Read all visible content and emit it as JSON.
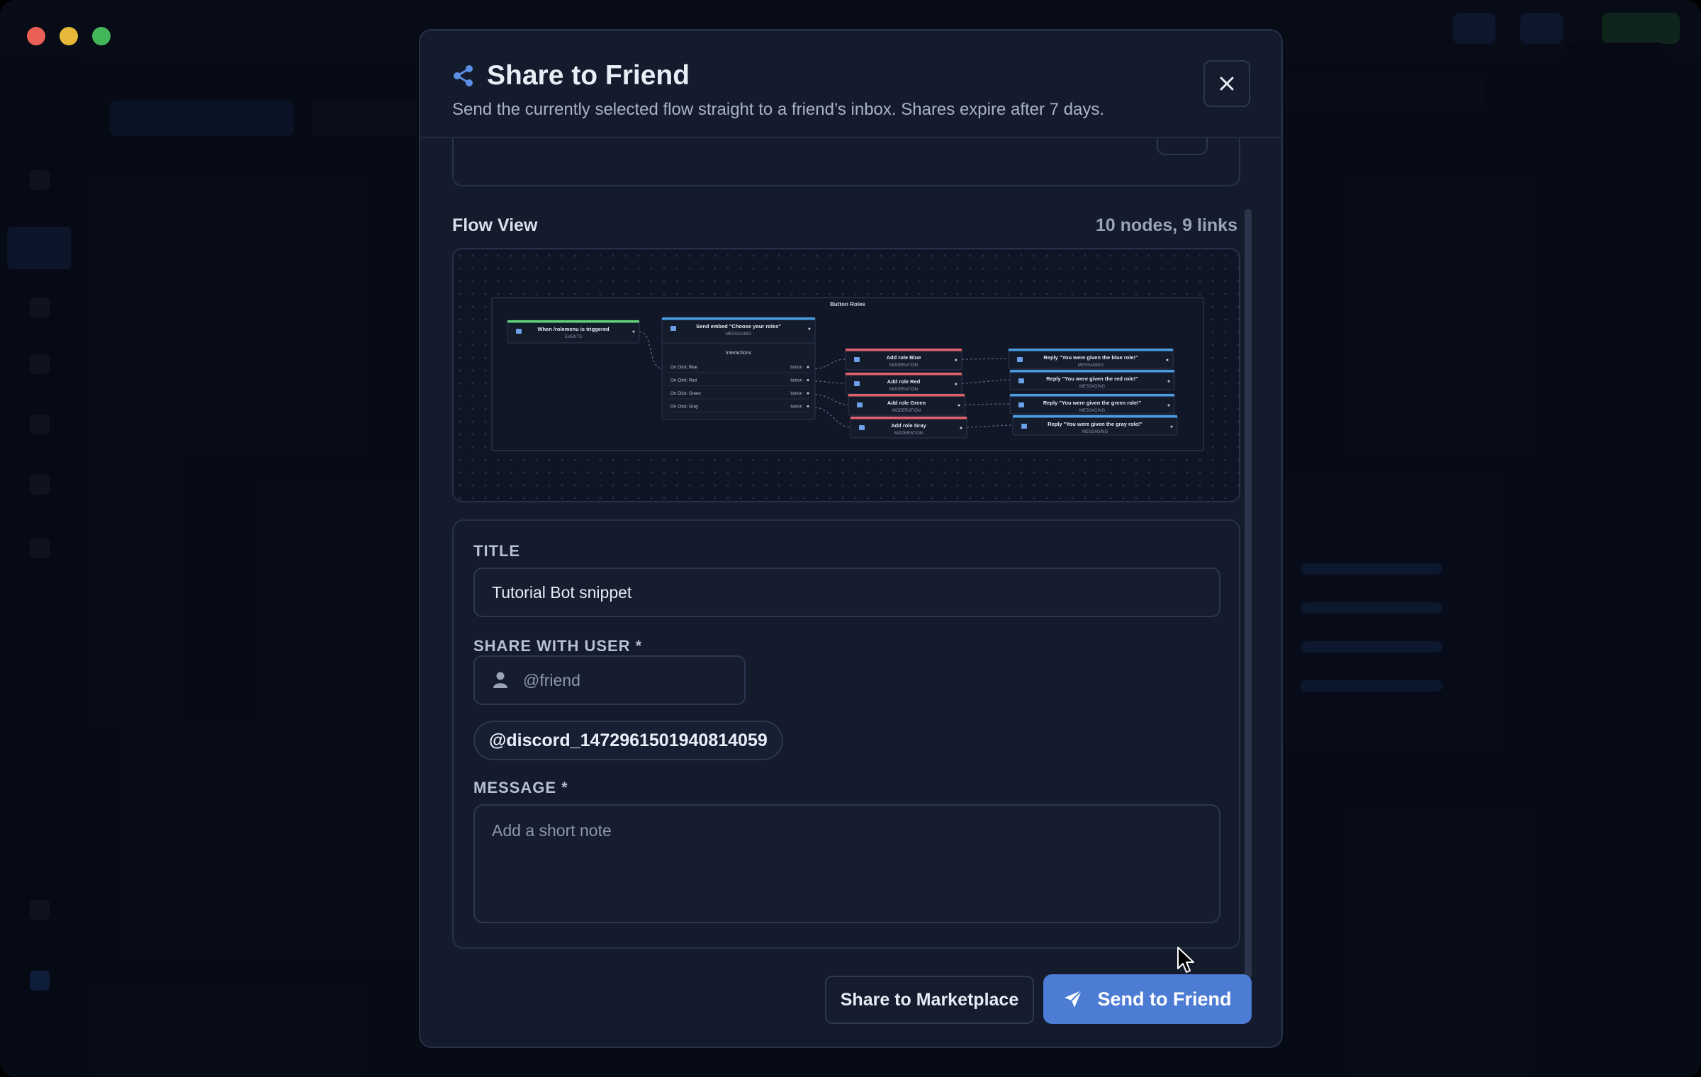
{
  "modal": {
    "title": "Share to Friend",
    "subtitle": "Send the currently selected flow straight to a friend’s inbox. Shares expire after 7 days.",
    "icons": {
      "title": "share-icon",
      "close": "close-icon"
    }
  },
  "flow_view": {
    "label": "Flow View",
    "meta": "10 nodes, 9 links",
    "group_title": "Button Roles",
    "nodes": [
      {
        "title": "When /rolemenu is triggered",
        "category": "EVENTS",
        "color": "#5fcf7a",
        "icon": "flag-icon"
      },
      {
        "title": "Send embed \"Choose your roles\"",
        "category": "MESSAGING",
        "color": "#4a9de0",
        "icon": "message-icon",
        "section": "Interactions",
        "rows": [
          {
            "label": "On Click: Blue",
            "type": "button"
          },
          {
            "label": "On Click: Red",
            "type": "button"
          },
          {
            "label": "On Click: Green",
            "type": "button"
          },
          {
            "label": "On Click: Gray",
            "type": "button"
          }
        ]
      },
      {
        "title": "Add role Blue",
        "category": "MODERATION",
        "color": "#e0606a",
        "icon": "users-icon"
      },
      {
        "title": "Add role Red",
        "category": "MODERATION",
        "color": "#e0606a",
        "icon": "users-icon"
      },
      {
        "title": "Add role Green",
        "category": "MODERATION",
        "color": "#e0606a",
        "icon": "users-icon"
      },
      {
        "title": "Add role Gray",
        "category": "MODERATION",
        "color": "#e0606a",
        "icon": "users-icon"
      },
      {
        "title": "Reply \"You were given the blue role!\"",
        "category": "MESSAGING",
        "color": "#4a9de0",
        "icon": "message-icon"
      },
      {
        "title": "Reply \"You were given the red role!\"",
        "category": "MESSAGING",
        "color": "#4a9de0",
        "icon": "message-icon"
      },
      {
        "title": "Reply \"You were given the green role!\"",
        "category": "MESSAGING",
        "color": "#4a9de0",
        "icon": "message-icon"
      },
      {
        "title": "Reply \"You were given the gray role!\"",
        "category": "MESSAGING",
        "color": "#4a9de0",
        "icon": "message-icon"
      }
    ]
  },
  "form": {
    "title_label": "TITLE",
    "title_value": "Tutorial Bot snippet",
    "share_label": "SHARE WITH USER *",
    "share_placeholder": "@friend",
    "share_icon": "user-icon",
    "selected_user": "@discord_1472961501940814059",
    "message_label": "MESSAGE *",
    "message_placeholder": "Add a short note"
  },
  "actions": {
    "secondary": "Share to Marketplace",
    "primary": "Send to Friend",
    "primary_icon": "send-icon",
    "primary_color": "#4d7cd4"
  },
  "window": {
    "controls": [
      "close",
      "minimize",
      "zoom"
    ]
  }
}
